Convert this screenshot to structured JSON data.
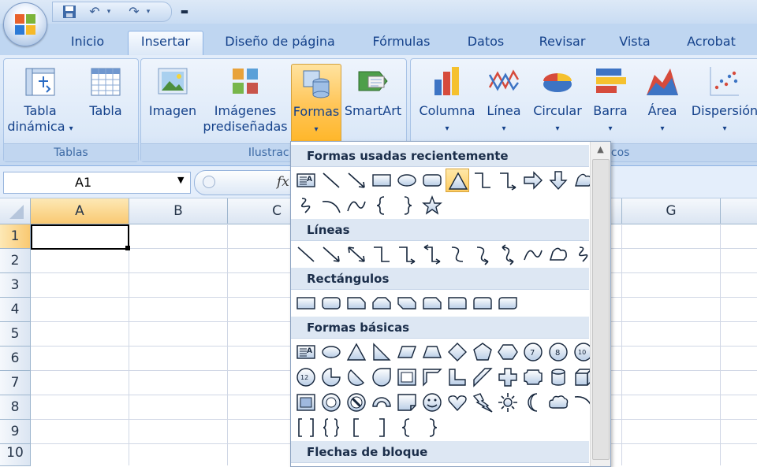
{
  "tabs": [
    "Inicio",
    "Insertar",
    "Diseño de página",
    "Fórmulas",
    "Datos",
    "Revisar",
    "Vista",
    "Acrobat"
  ],
  "active_tab": "Insertar",
  "ribbon": {
    "tablas": {
      "label": "Tablas",
      "tabla_dinamica_line1": "Tabla",
      "tabla_dinamica_line2": "dinámica",
      "tabla": "Tabla"
    },
    "ilustraciones": {
      "label": "Ilustracio",
      "imagen": "Imagen",
      "imagenes_line1": "Imágenes",
      "imagenes_line2": "prediseñadas",
      "formas": "Formas",
      "smartart": "SmartArt"
    },
    "graficos": {
      "label": "icos",
      "columna": "Columna",
      "linea": "Línea",
      "circular": "Circular",
      "barra": "Barra",
      "area": "Área",
      "dispersion": "Dispersión"
    }
  },
  "formula_bar": {
    "name_box": "A1",
    "fx": "fx"
  },
  "sheet": {
    "columns": [
      "A",
      "B",
      "C",
      "",
      "",
      "",
      "G"
    ],
    "rows": [
      "1",
      "2",
      "3",
      "4",
      "5",
      "6",
      "7",
      "8",
      "9",
      "10"
    ],
    "selected_cell": "A1"
  },
  "shapes_panel": {
    "sections": {
      "recent": "Formas usadas recientemente",
      "lines": "Líneas",
      "rects": "Rectángulos",
      "basic": "Formas básicas",
      "block_arrows": "Flechas de bloque"
    }
  },
  "colors": {
    "ribbon_bg": "#d6e5f7",
    "tab_text": "#15428b",
    "formas_highlight": "#ffc65a",
    "header_bg": "#dde7f3"
  }
}
